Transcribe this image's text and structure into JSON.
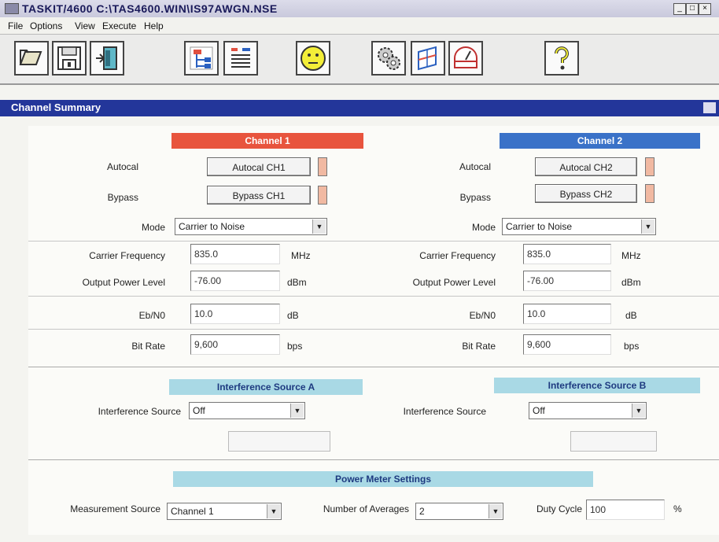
{
  "window": {
    "title": "TASKIT/4600   C:\\TAS4600.WIN\\IS97AWGN.NSE",
    "minimize": "_",
    "maximize": "□",
    "close": "×"
  },
  "menu": [
    "File",
    "Options",
    "View",
    "Execute",
    "Help"
  ],
  "toolbar": {
    "icons": [
      "open-folder-icon",
      "save-disk-icon",
      "exit-door-icon",
      "channel-config-icon",
      "list-icon",
      "smiley-icon",
      "gears-icon",
      "graph-icon",
      "meter-icon",
      "help-question-icon"
    ]
  },
  "section": {
    "title": "Channel Summary"
  },
  "channel1": {
    "header": "Channel 1",
    "autocal_label": "Autocal",
    "autocal_button": "Autocal CH1",
    "bypass_label": "Bypass",
    "bypass_button": "Bypass CH1",
    "mode_label": "Mode",
    "mode_value": "Carrier to Noise",
    "carrier_freq_label": "Carrier Frequency",
    "carrier_freq_value": "835.0",
    "carrier_freq_unit": "MHz",
    "output_power_label": "Output Power Level",
    "output_power_value": "-76.00",
    "output_power_unit": "dBm",
    "ebno_label": "Eb/N0",
    "ebno_value": "10.0",
    "ebno_unit": "dB",
    "bitrate_label": "Bit Rate",
    "bitrate_value": "9,600",
    "bitrate_unit": "bps"
  },
  "channel2": {
    "header": "Channel 2",
    "autocal_label": "Autocal",
    "autocal_button": "Autocal CH2",
    "bypass_label": "Bypass",
    "bypass_button": "Bypass CH2",
    "mode_label": "Mode",
    "mode_value": "Carrier to Noise",
    "carrier_freq_label": "Carrier Frequency",
    "carrier_freq_value": "835.0",
    "carrier_freq_unit": "MHz",
    "output_power_label": "Output Power Level",
    "output_power_value": "-76.00",
    "output_power_unit": "dBm",
    "ebno_label": "Eb/N0",
    "ebno_value": "10.0",
    "ebno_unit": "dB",
    "bitrate_label": "Bit Rate",
    "bitrate_value": "9,600",
    "bitrate_unit": "bps"
  },
  "interference_a": {
    "header": "Interference Source A",
    "label": "Interference Source",
    "value": "Off"
  },
  "interference_b": {
    "header": "Interference Source B",
    "label": "Interference Source",
    "value": "Off"
  },
  "power_meter": {
    "header": "Power Meter Settings",
    "measurement_source_label": "Measurement Source",
    "measurement_source_value": "Channel 1",
    "num_averages_label": "Number of Averages",
    "num_averages_value": "2",
    "duty_cycle_label": "Duty Cycle",
    "duty_cycle_value": "100",
    "duty_cycle_unit": "%"
  },
  "colors": {
    "channel1": "#e8543e",
    "channel2": "#3a72c8",
    "interference": "#a9d9e5",
    "power_meter": "#a9d9e5",
    "section_bar": "#23369a"
  }
}
